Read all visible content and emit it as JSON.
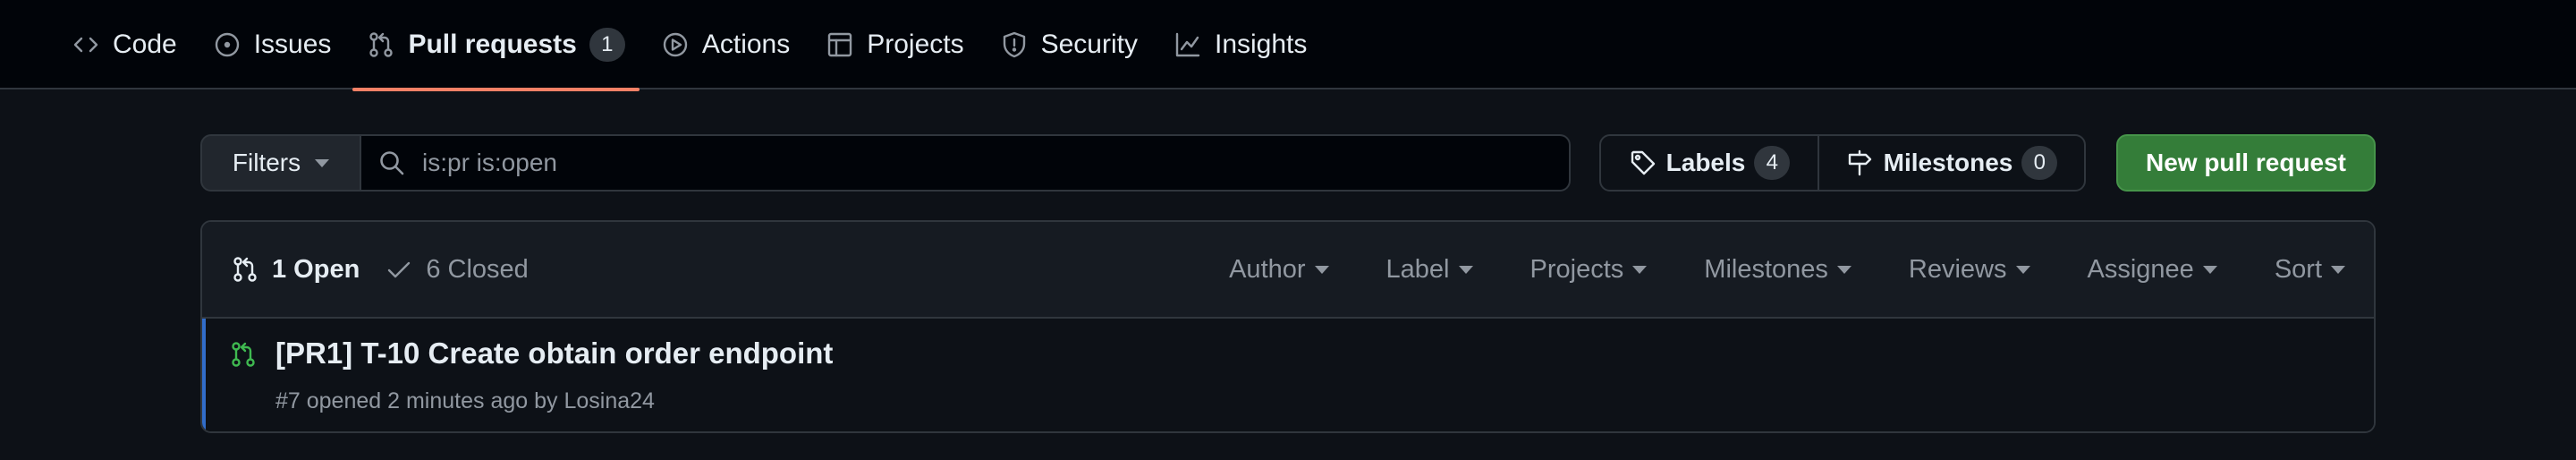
{
  "nav": {
    "tabs": [
      {
        "label": "Code",
        "icon": "code-icon"
      },
      {
        "label": "Issues",
        "icon": "issue-opened-icon"
      },
      {
        "label": "Pull requests",
        "icon": "git-pull-request-icon",
        "count": "1",
        "active": true
      },
      {
        "label": "Actions",
        "icon": "play-icon"
      },
      {
        "label": "Projects",
        "icon": "table-icon"
      },
      {
        "label": "Security",
        "icon": "shield-icon"
      },
      {
        "label": "Insights",
        "icon": "graph-icon"
      }
    ],
    "active_underline_color": "#f78166"
  },
  "toolbar": {
    "filters_label": "Filters",
    "search_value": "is:pr is:open",
    "labels_label": "Labels",
    "labels_count": "4",
    "milestones_label": "Milestones",
    "milestones_count": "0",
    "new_pr_label": "New pull request",
    "new_pr_color": "#347d39"
  },
  "list": {
    "open_label": "1 Open",
    "closed_label": "6 Closed",
    "filters": [
      "Author",
      "Label",
      "Projects",
      "Milestones",
      "Reviews",
      "Assignee",
      "Sort"
    ],
    "items": [
      {
        "title": "[PR1] T-10 Create obtain order endpoint",
        "meta": "#7 opened 2 minutes ago by Losina24",
        "icon": "git-pull-request-icon",
        "status_color": "#3fb950"
      }
    ]
  }
}
